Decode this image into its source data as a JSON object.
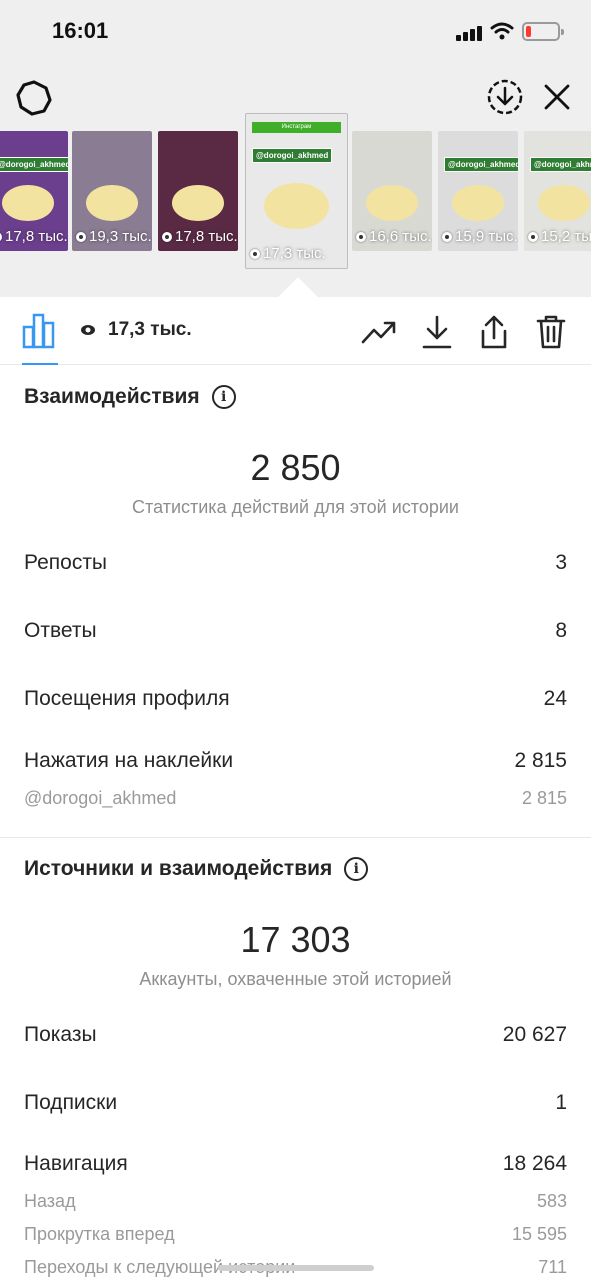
{
  "status_bar": {
    "time": "16:01"
  },
  "header": {
    "settings_icon": "gear-icon",
    "download_all_icon": "download-circle-icon",
    "close_icon": "close-icon"
  },
  "thumbnails": [
    {
      "views": "17,8 тыс.",
      "handle": "@dorogoi_akhmed",
      "bg": "#6b3f8e"
    },
    {
      "views": "19,3 тыс.",
      "handle": "",
      "bg": "#8a7c93"
    },
    {
      "views": "17,8 тыс.",
      "handle": "",
      "bg": "#5a2a45"
    },
    {
      "views": "17,3 тыс.",
      "handle": "@dorogoi_akhmed",
      "sticker": "Инстаграм",
      "bg": "#e9e9ea",
      "active": true
    },
    {
      "views": "16,6 тыс.",
      "handle": "",
      "bg": "#d9d9d4"
    },
    {
      "views": "15,9 тыс.",
      "handle": "@dorogoi_akhmed",
      "bg": "#dcdcdc"
    },
    {
      "views": "15,2 тыс.",
      "handle": "@dorogoi_akhmed",
      "bg": "#e2e2df"
    }
  ],
  "toolbar": {
    "insights_icon": "bar-chart-icon",
    "reach_value": "17,3 тыс.",
    "trend_icon": "trend-up-icon",
    "download_icon": "download-icon",
    "share_icon": "share-icon",
    "delete_icon": "trash-icon"
  },
  "interactions": {
    "title": "Взаимодействия",
    "total": "2 850",
    "caption": "Статистика действий для этой истории",
    "rows": [
      {
        "label": "Репосты",
        "value": "3"
      },
      {
        "label": "Ответы",
        "value": "8"
      },
      {
        "label": "Посещения профиля",
        "value": "24"
      },
      {
        "label": "Нажатия на наклейки",
        "value": "2 815"
      }
    ],
    "sticker_sub": {
      "label": "@dorogoi_akhmed",
      "value": "2 815"
    }
  },
  "discovery": {
    "title": "Источники и взаимодействия",
    "total": "17 303",
    "caption": "Аккаунты, охваченные этой историей",
    "rows": [
      {
        "label": "Показы",
        "value": "20 627"
      },
      {
        "label": "Подписки",
        "value": "1"
      },
      {
        "label": "Навигация",
        "value": "18 264"
      }
    ],
    "navigation_sub": [
      {
        "label": "Назад",
        "value": "583"
      },
      {
        "label": "Прокрутка вперед",
        "value": "15 595"
      },
      {
        "label": "Переходы к следующей истории",
        "value": "711"
      }
    ]
  },
  "colors": {
    "accent": "#3897f0",
    "sticker_green": "#3fae29",
    "battery_low": "#ff3b30"
  }
}
